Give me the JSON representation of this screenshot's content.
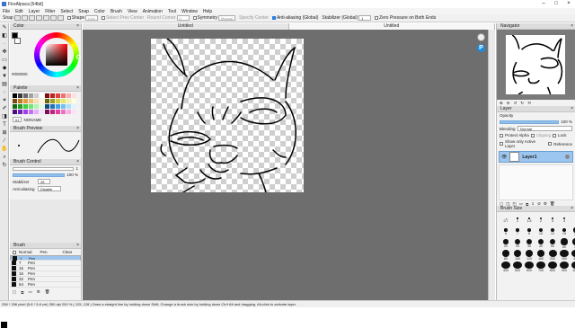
{
  "window": {
    "title": "FireAlpaca [64bit]",
    "min": "–",
    "max": "□",
    "close": "×"
  },
  "menu": [
    "File",
    "Edit",
    "Layer",
    "Filter",
    "Select",
    "Snap",
    "Color",
    "Brush",
    "View",
    "Animation",
    "Tool",
    "Window",
    "Help"
  ],
  "toolbar": {
    "snap_label": "Snap",
    "snap_value": "Line",
    "shape_label": "Shape",
    "shape_value": "Line",
    "select_prev_center": "Select Prev Center",
    "round_corner": "Round Corner",
    "round_corner_value": "0",
    "symmetry": "Symmetry",
    "symmetry_value": "Manual",
    "specify_center": "Specify Center",
    "anti_aliasing": "Anti-aliasing (Global)",
    "stabilizer_label": "Stabilizer (Global)",
    "stabilizer_value": "1",
    "zero_pressure": "Zero Pressure on Both Ends"
  },
  "tabs": [
    "Untitled",
    "Untitled"
  ],
  "color_panel": {
    "title": "Color",
    "hex": "#000000"
  },
  "palette": {
    "title": "Palette",
    "index": "#1",
    "name": "NONAME",
    "colors": [
      "#000000",
      "#3a3a3a",
      "#6a6a6a",
      "#a0a0a0",
      "#d0d0d0",
      "#ffffff",
      "#7a1010",
      "#c02020",
      "#e04040",
      "#f07070",
      "#f8b0b0",
      "#ffe0e0",
      "#7a4a10",
      "#c07a20",
      "#e0a040",
      "#f0c070",
      "#f8e0b0",
      "#fff4e0",
      "#6a6a10",
      "#a0a020",
      "#d0d040",
      "#e8e870",
      "#f4f4b0",
      "#fffce0",
      "#106a10",
      "#20a020",
      "#40d040",
      "#70e870",
      "#b0f4b0",
      "#e0ffe0",
      "#104a7a",
      "#2070c0",
      "#40a0e0",
      "#70c0f0",
      "#b0e0f8",
      "#e0f4ff",
      "#4a107a",
      "#7020c0",
      "#a040e0",
      "#c070f0",
      "#e0b0f8",
      "#f4e0ff",
      "#7a1050",
      "#c02080",
      "#e040a0",
      "#f070c0",
      "#f8b0e0",
      "#ffe0f4"
    ]
  },
  "brush_preview": {
    "title": "Brush Preview"
  },
  "brush_control": {
    "title": "Brush Control",
    "size": "1",
    "opacity": "100 %",
    "stabilizer_label": "Stabilizer",
    "stabilizer_value": "28",
    "aa_label": "Anti-aliasing",
    "aa_value": "Disable"
  },
  "brush": {
    "title": "Brush",
    "col_normal": "Normal",
    "col_pen": "Pen",
    "col_clear": "Clear",
    "items": [
      {
        "size": "1",
        "name": "Pen"
      },
      {
        "size": "7",
        "name": "Pen"
      },
      {
        "size": "15",
        "name": "Pen"
      },
      {
        "size": "16",
        "name": "Pen"
      },
      {
        "size": "32",
        "name": "Pen"
      },
      {
        "size": "64",
        "name": "Pen"
      }
    ]
  },
  "navigator": {
    "title": "Navigator"
  },
  "layer": {
    "title": "Layer",
    "opacity_label": "Opacity",
    "opacity_value": "100 %",
    "blending_label": "Blending",
    "blending_value": "Normal",
    "protect_alpha": "Protect Alpha",
    "clipping": "Clipping",
    "lock": "Lock",
    "show_active": "Show only Active Layer",
    "reference": "Reference",
    "layer_name": "Layer1"
  },
  "brush_size": {
    "title": "Brush Size",
    "labels": [
      "0.7",
      "1",
      "1.5",
      "2",
      "3",
      "4",
      "5",
      "6",
      "7",
      "8",
      "10",
      "12",
      "15",
      "18",
      "20",
      "25",
      "30",
      "40",
      "50",
      "60",
      "70",
      "80",
      "100",
      "120",
      "150",
      "200",
      "250",
      "300",
      "400",
      "500",
      "600",
      "700",
      "800",
      "900",
      "1000"
    ]
  },
  "status": "256 * 256 pixel  (5.8 * 5.8 cm)  350 dpi  200 %  ( 125, 128 )  Draw a straight line by holding down Shift, Change a brush size by holding down Ctrl+Alt and dragging. Alt-click to activate layer."
}
